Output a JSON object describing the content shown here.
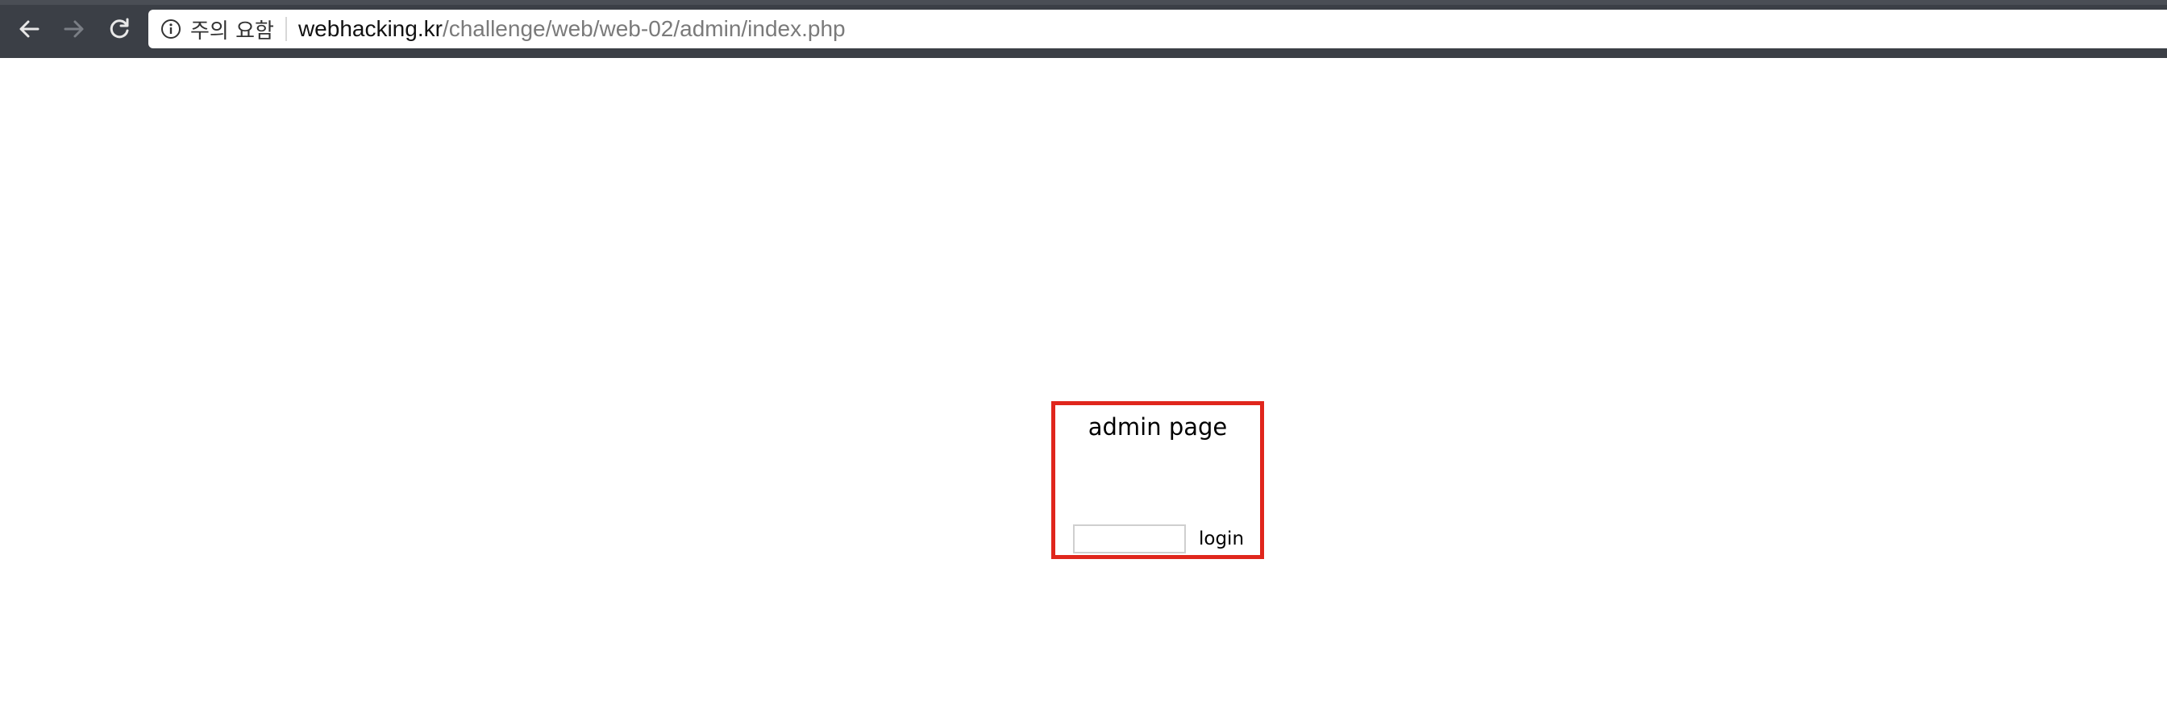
{
  "browser": {
    "security_label": "주의 요함",
    "url_host": "webhacking.kr",
    "url_path": "/challenge/web/web-02/admin/index.php",
    "icons": {
      "back": "arrow-left-icon",
      "forward": "arrow-right-icon",
      "reload": "reload-icon",
      "info": "info-circle-icon"
    }
  },
  "page": {
    "title": "admin page",
    "login_input_value": "",
    "login_label": "login",
    "box_border_color": "#e0261c"
  }
}
